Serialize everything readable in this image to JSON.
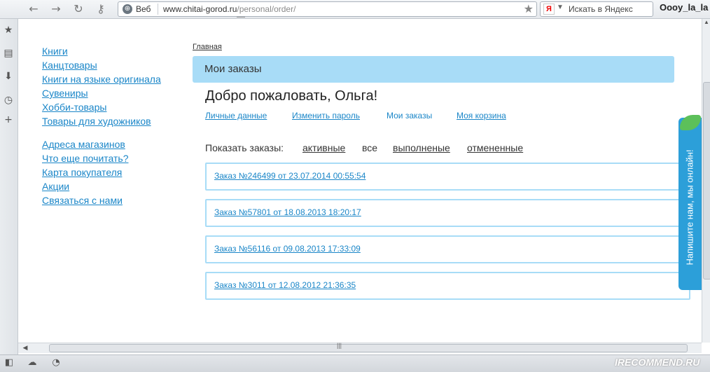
{
  "browser": {
    "web_label": "Веб",
    "url_host": "www.chitai-gorod.ru",
    "url_path": "/personal/order/",
    "search_placeholder": "Искать в Яндекс",
    "user_name": "Oooy_la_la"
  },
  "sidebar": {
    "group1": [
      "Книги",
      "Канцтовары",
      "Книги на языке оригинала",
      "Сувениры",
      "Хобби-товары",
      "Товары для художников"
    ],
    "group2": [
      "Адреса магазинов",
      "Что еще почитать?",
      "Карта покупателя",
      "Акции",
      "Связаться с нами"
    ]
  },
  "main": {
    "breadcrumb": "Главная",
    "section_title": "Мои заказы",
    "welcome": "Добро пожаловать, Ольга!",
    "profile_tabs": [
      "Личные данные",
      "Изменить пароль",
      "Мои заказы",
      "Моя корзина"
    ],
    "filter": {
      "label": "Показать заказы:",
      "options": [
        "активные",
        "все",
        "выполненые",
        "отмененные"
      ]
    },
    "orders": [
      "Заказ №246499 от 23.07.2014 00:55:54",
      "Заказ №57801 от 18.08.2013 18:20:17",
      "Заказ №56116 от 09.08.2013 17:33:09",
      "Заказ №3011 от 12.08.2012 21:36:35"
    ]
  },
  "chat_widget": {
    "label": "Напишите нам, мы онлайн!"
  },
  "watermark": "IRECOMMEND.RU",
  "colors": {
    "link": "#1a86c8",
    "header_bg": "#a8dcf7",
    "chat_bg": "#2c9fd9"
  }
}
